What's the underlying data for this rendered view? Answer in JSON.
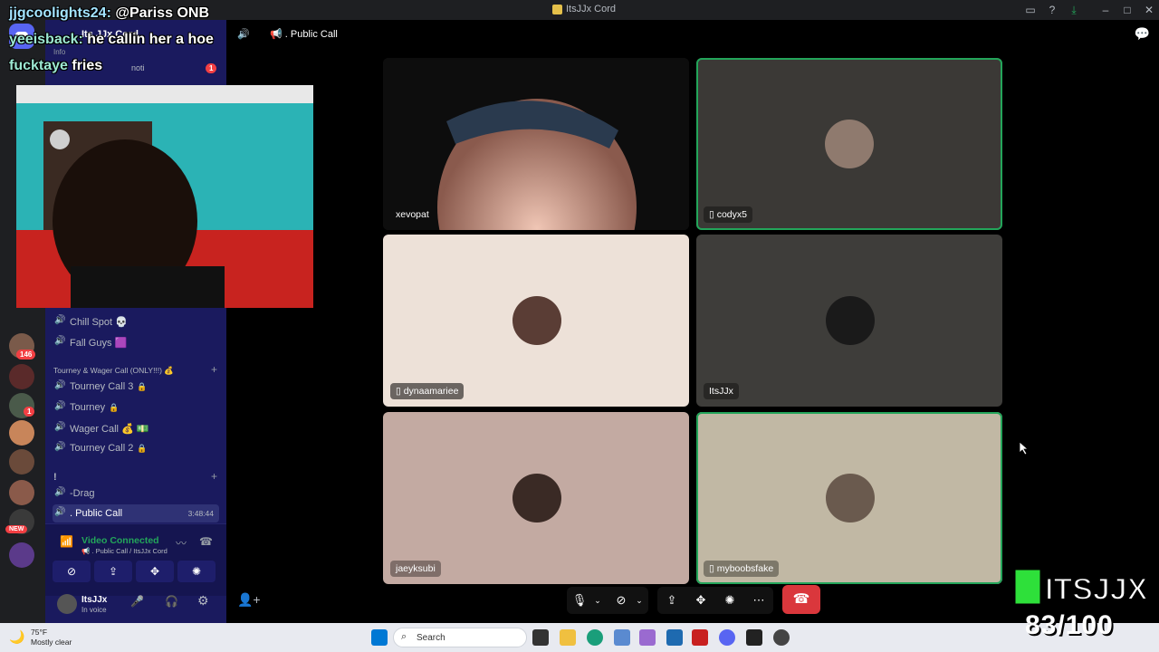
{
  "window": {
    "title": "ItsJJx Cord"
  },
  "server": {
    "name": "Its JJx Cord",
    "info_label": "Info",
    "noti_label": "noti",
    "noti_badge": "1"
  },
  "rail_badges": {
    "b1": "146",
    "b2": "1",
    "new": "NEW"
  },
  "channels": [
    {
      "label": "Chill Spot",
      "suffix": "💀"
    },
    {
      "label": "Fall Guys",
      "suffix": "🟪"
    }
  ],
  "category_tourney": "Tourney & Wager Call (ONLY!!!) 💰",
  "tourney_channels": [
    {
      "label": "Tourney Call 3"
    },
    {
      "label": "Tourney"
    },
    {
      "label": "Wager Call 💰 💵"
    },
    {
      "label": "Tourney Call 2"
    }
  ],
  "category_bang": "!",
  "drag_channel": "-Drag",
  "public_call": {
    "label": ". Public Call",
    "timer": "3:48:44"
  },
  "voice": {
    "status": "Video Connected",
    "sub": "📢 . Public Call / ItsJJx Cord"
  },
  "user": {
    "name": "ItsJJx",
    "status": "In voice"
  },
  "call_header": {
    "label": "📢 . Public Call"
  },
  "tiles": [
    {
      "name": "xevopat",
      "mobile": false,
      "bg": "#1b1b1b",
      "speaking": false
    },
    {
      "name": "codyx5",
      "mobile": true,
      "bg": "#3b3936",
      "speaking": true
    },
    {
      "name": "dynaamariee",
      "mobile": true,
      "bg": "#ede1d8",
      "speaking": false
    },
    {
      "name": "ItsJJx",
      "mobile": false,
      "bg": "#3e3d3a",
      "speaking": false
    },
    {
      "name": "jaeyksubi",
      "mobile": false,
      "bg": "#c3aaa2",
      "speaking": false
    },
    {
      "name": "myboobsfake",
      "mobile": true,
      "bg": "#c1b8a4",
      "speaking": true
    }
  ],
  "stream_overlay": {
    "chat": [
      {
        "user": "jjgcoolights24:",
        "msg": "@Pariss ONB"
      },
      {
        "user": "yeeisback:",
        "msg": "he callin her a hoe"
      },
      {
        "user": "fucktaye",
        "msg": "fries"
      }
    ],
    "logo_text": "ITSJJX",
    "counter": "83/100"
  },
  "taskbar": {
    "temp": "75°F",
    "weather": "Mostly clear",
    "search_placeholder": "Search"
  },
  "colors": {
    "sidebar": "#1a1a5e",
    "connected": "#23a55a",
    "hangup": "#da373c",
    "accent_green": "#2ee03a"
  }
}
